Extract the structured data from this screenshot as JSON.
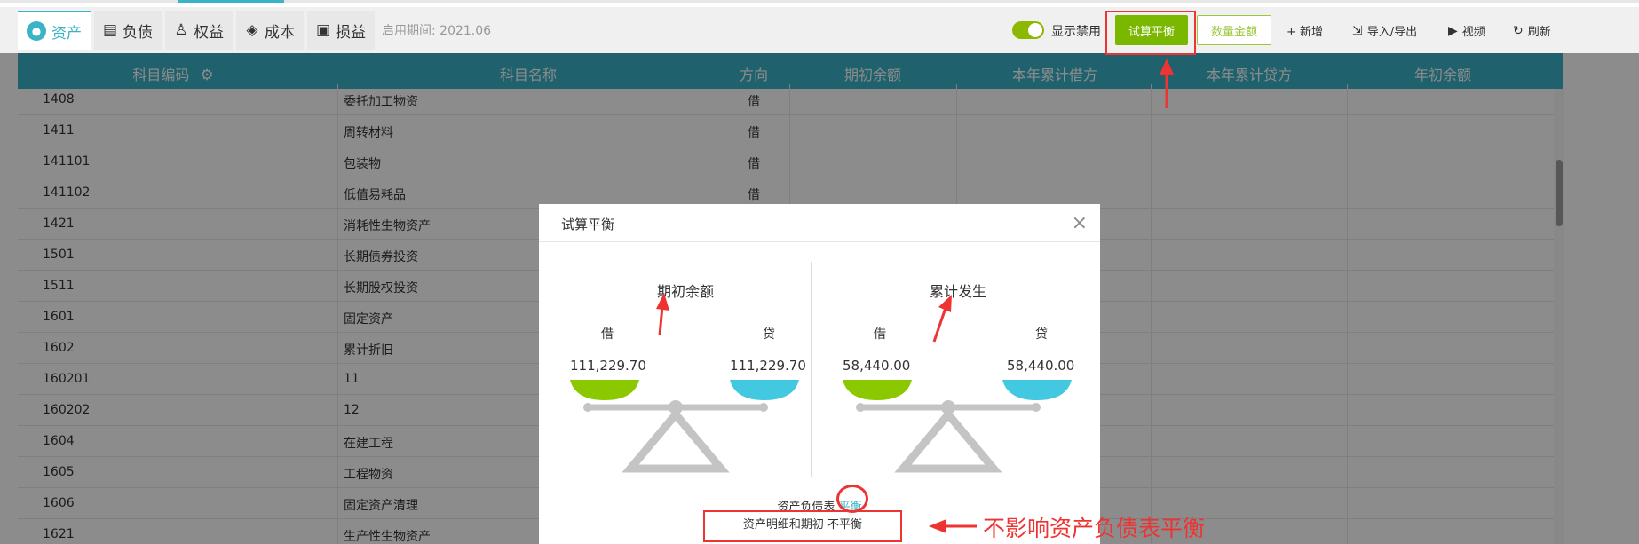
{
  "toolbar": {
    "tabs": [
      {
        "label": "资产",
        "icon": "asset-icon"
      },
      {
        "label": "负债",
        "icon": "liability-icon"
      },
      {
        "label": "权益",
        "icon": "equity-icon"
      },
      {
        "label": "成本",
        "icon": "cost-icon"
      },
      {
        "label": "损益",
        "icon": "profit-loss-icon"
      }
    ],
    "period": "启用期间: 2021.06",
    "toggle_label": "显示禁用",
    "toggle_on": true,
    "balance_button": "试算平衡",
    "qty_button": "数量金额",
    "add_label": "+ 新增",
    "import_export_label": "导入/导出",
    "video_label": "视频",
    "refresh_label": "刷新"
  },
  "table": {
    "columns": [
      "科目编码",
      "科目名称",
      "方向",
      "期初余额",
      "本年累计借方",
      "本年累计贷方",
      "年初余额"
    ],
    "rows": [
      {
        "code": "1408",
        "name": "委托加工物资",
        "dir": "借"
      },
      {
        "code": "1411",
        "name": "周转材料",
        "dir": "借"
      },
      {
        "code": "141101",
        "name": "包装物",
        "dir": "借"
      },
      {
        "code": "141102",
        "name": "低值易耗品",
        "dir": "借"
      },
      {
        "code": "1421",
        "name": "消耗性生物资产",
        "dir": ""
      },
      {
        "code": "1501",
        "name": "长期债券投资",
        "dir": ""
      },
      {
        "code": "1511",
        "name": "长期股权投资",
        "dir": ""
      },
      {
        "code": "1601",
        "name": "固定资产",
        "dir": ""
      },
      {
        "code": "1602",
        "name": "累计折旧",
        "dir": ""
      },
      {
        "code": "160201",
        "name": "11",
        "dir": ""
      },
      {
        "code": "160202",
        "name": "12",
        "dir": ""
      },
      {
        "code": "1604",
        "name": "在建工程",
        "dir": ""
      },
      {
        "code": "1605",
        "name": "工程物资",
        "dir": ""
      },
      {
        "code": "1606",
        "name": "固定资产清理",
        "dir": ""
      },
      {
        "code": "1621",
        "name": "生产性生物资产",
        "dir": ""
      }
    ]
  },
  "dialog": {
    "title": "试算平衡",
    "close": "×",
    "left": {
      "title": "期初余额",
      "debit_label": "借",
      "credit_label": "贷",
      "debit": "111,229.70",
      "credit": "111,229.70"
    },
    "right": {
      "title": "累计发生",
      "debit_label": "借",
      "credit_label": "贷",
      "debit": "58,440.00",
      "credit": "58,440.00"
    },
    "footer_prefix": "资产负债表",
    "footer_link": "平衡",
    "footer_detail": "资产明细和期初 不平衡"
  },
  "annotation": "不影响资产负债表平衡",
  "colors": {
    "teal": "#3ab3c7",
    "green": "#7ab800",
    "red": "#e33",
    "pan_green": "#8cc800",
    "pan_blue": "#42c8e0"
  }
}
